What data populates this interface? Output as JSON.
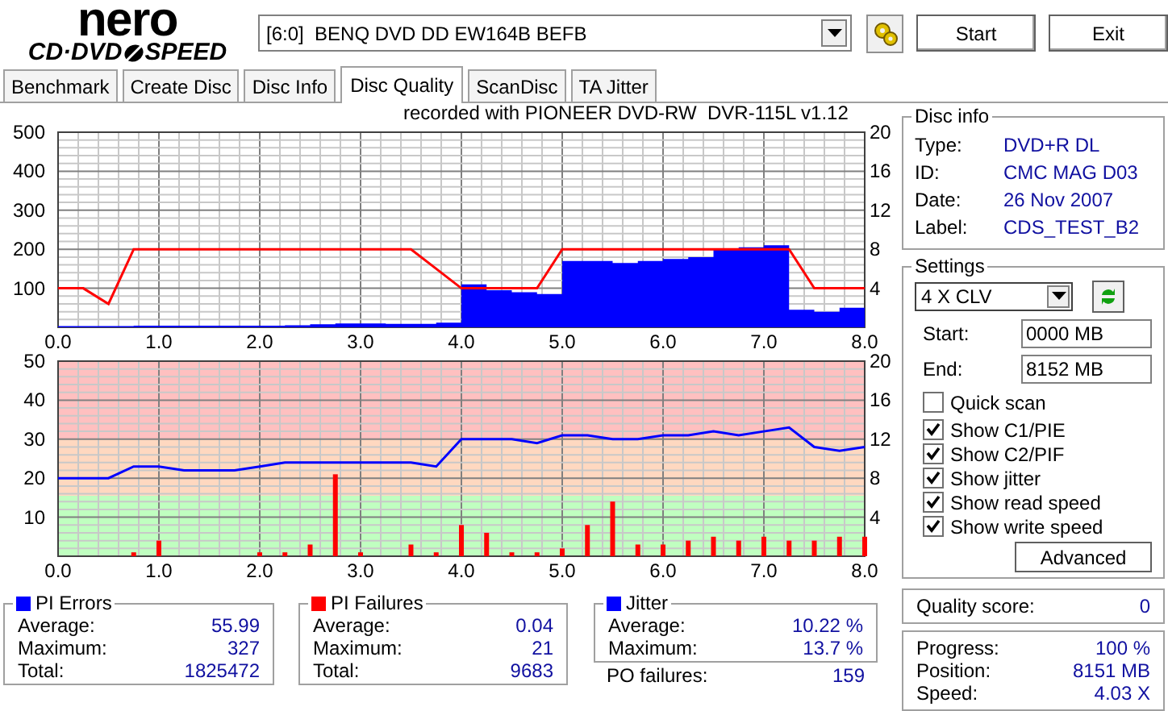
{
  "logo": {
    "word": "nero",
    "left": "CD·DVD",
    "right": "SPEED"
  },
  "drive": {
    "value": "[6:0]  BENQ DVD DD EW164B BEFB"
  },
  "buttons": [
    {
      "label": "Start"
    },
    {
      "label": "Exit"
    }
  ],
  "tabs": [
    {
      "label": "Benchmark",
      "selected": false
    },
    {
      "label": "Create Disc",
      "selected": false
    },
    {
      "label": "Disc Info",
      "selected": false
    },
    {
      "label": "Disc Quality",
      "selected": true
    },
    {
      "label": "ScanDisc",
      "selected": false
    },
    {
      "label": "TA Jitter",
      "selected": false
    }
  ],
  "caption": "recorded with PIONEER DVD-RW  DVR-115L v1.12",
  "charts": [
    {
      "right_axis_labels": [
        "20",
        "16",
        "12",
        "8",
        "4"
      ],
      "chart_data": {
        "type": "area",
        "grid": true,
        "xlim": [
          0,
          8
        ],
        "ylim": [
          0,
          500
        ],
        "xticks": [
          {
            "value": 0,
            "label": "0.0"
          },
          {
            "value": 1,
            "label": "1.0"
          },
          {
            "value": 2,
            "label": "2.0"
          },
          {
            "value": 3,
            "label": "3.0"
          },
          {
            "value": 4,
            "label": "4.0"
          },
          {
            "value": 5,
            "label": "5.0"
          },
          {
            "value": 6,
            "label": "6.0"
          },
          {
            "value": 7,
            "label": "7.0"
          },
          {
            "value": 8,
            "label": "8.0"
          }
        ],
        "yticks": [
          100,
          200,
          300,
          400,
          500
        ],
        "x": [
          0,
          0.25,
          0.5,
          0.75,
          1,
          1.25,
          1.5,
          1.75,
          2,
          2.25,
          2.5,
          2.75,
          3,
          3.25,
          3.5,
          3.75,
          4,
          4.25,
          4.5,
          4.75,
          5,
          5.25,
          5.5,
          5.75,
          6,
          6.25,
          6.5,
          6.75,
          7,
          7.25,
          7.5,
          7.75,
          8
        ],
        "series": [
          {
            "color": "#0000ff",
            "values": [
              3,
              3,
              3,
              4,
              4,
              4,
              4,
              4,
              4,
              5,
              8,
              10,
              10,
              9,
              9,
              12,
              110,
              95,
              90,
              85,
              170,
              170,
              165,
              170,
              175,
              180,
              200,
              205,
              210,
              45,
              40,
              50,
              55
            ]
          },
          {
            "color": "#ff0000",
            "type": "line",
            "values": [
              100,
              100,
              60,
              200,
              200,
              200,
              200,
              200,
              200,
              200,
              200,
              200,
              200,
              200,
              200,
              150,
              100,
              100,
              100,
              100,
              200,
              200,
              200,
              200,
              200,
              200,
              200,
              200,
              200,
              200,
              100,
              100,
              100
            ]
          }
        ]
      }
    },
    {
      "right_axis_labels": [
        "20",
        "16",
        "12",
        "8",
        "4"
      ],
      "zones": [
        {
          "color": "#c0ffc0"
        },
        {
          "color": "#ffd8c0"
        },
        {
          "color": "#ffc0c0"
        }
      ],
      "chart_data": {
        "type": "line",
        "grid": true,
        "xlim": [
          0,
          8
        ],
        "ylim": [
          0,
          50
        ],
        "xticks": [
          {
            "value": 0,
            "label": "0.0"
          },
          {
            "value": 1,
            "label": "1.0"
          },
          {
            "value": 2,
            "label": "2.0"
          },
          {
            "value": 3,
            "label": "3.0"
          },
          {
            "value": 4,
            "label": "4.0"
          },
          {
            "value": 5,
            "label": "5.0"
          },
          {
            "value": 6,
            "label": "6.0"
          },
          {
            "value": 7,
            "label": "7.0"
          },
          {
            "value": 8,
            "label": "8.0"
          }
        ],
        "yticks": [
          10,
          20,
          30,
          40,
          50
        ],
        "x": [
          0,
          0.25,
          0.5,
          0.75,
          1,
          1.25,
          1.5,
          1.75,
          2,
          2.25,
          2.5,
          2.75,
          3,
          3.25,
          3.5,
          3.75,
          4,
          4.25,
          4.5,
          4.75,
          5,
          5.25,
          5.5,
          5.75,
          6,
          6.25,
          6.5,
          6.75,
          7,
          7.25,
          7.5,
          7.75,
          8
        ],
        "series": [
          {
            "color": "#ff0000",
            "type": "bar",
            "values": [
              0,
              0,
              0,
              1,
              4,
              0,
              0,
              0,
              1,
              1,
              3,
              21,
              1,
              0,
              3,
              1,
              8,
              6,
              1,
              1,
              2,
              8,
              14,
              3,
              3,
              4,
              5,
              4,
              5,
              4,
              4,
              5,
              5
            ]
          },
          {
            "color": "#0000ff",
            "values": [
              20,
              20,
              20,
              23,
              23,
              22,
              22,
              22,
              23,
              24,
              24,
              24,
              24,
              24,
              24,
              23,
              30,
              30,
              30,
              29,
              31,
              31,
              30,
              30,
              31,
              31,
              32,
              31,
              32,
              33,
              28,
              27,
              28
            ]
          }
        ]
      }
    }
  ],
  "stats": [
    {
      "title": "PI Errors",
      "color": "#0000ff",
      "rows": [
        {
          "label": "Average:",
          "value": "55.99"
        },
        {
          "label": "Maximum:",
          "value": "327"
        },
        {
          "label": "Total:",
          "value": "1825472"
        }
      ]
    },
    {
      "title": "PI Failures",
      "color": "#ff0000",
      "rows": [
        {
          "label": "Average:",
          "value": "0.04"
        },
        {
          "label": "Maximum:",
          "value": "21"
        },
        {
          "label": "Total:",
          "value": "9683"
        }
      ]
    },
    {
      "title": "Jitter",
      "color": "#0000ff",
      "rows": [
        {
          "label": "Average:",
          "value": "10.22 %"
        },
        {
          "label": "Maximum:",
          "value": "13.7 %"
        }
      ]
    }
  ],
  "po_failures": {
    "label": "PO failures:",
    "value": "159"
  },
  "disc_info": {
    "title": "Disc info",
    "rows": [
      {
        "label": "Type:",
        "value": "DVD+R DL"
      },
      {
        "label": "ID:",
        "value": "CMC MAG D03"
      },
      {
        "label": "Date:",
        "value": "26 Nov 2007"
      },
      {
        "label": "Label:",
        "value": "CDS_TEST_B2"
      }
    ]
  },
  "settings": {
    "title": "Settings",
    "speed": "4 X CLV",
    "start": {
      "label": "Start:",
      "value": "0000 MB"
    },
    "end": {
      "label": "End:",
      "value": "8152 MB"
    },
    "options": [
      {
        "label": "Quick scan",
        "checked": false
      },
      {
        "label": "Show C1/PIE",
        "checked": true
      },
      {
        "label": "Show C2/PIF",
        "checked": true
      },
      {
        "label": "Show jitter",
        "checked": true
      },
      {
        "label": "Show read speed",
        "checked": true
      },
      {
        "label": "Show write speed",
        "checked": true
      }
    ],
    "advanced": "Advanced"
  },
  "quality": {
    "label": "Quality score:",
    "value": "0"
  },
  "progress": [
    {
      "label": "Progress:",
      "value": "100 %"
    },
    {
      "label": "Position:",
      "value": "8151 MB"
    },
    {
      "label": "Speed:",
      "value": "4.03 X"
    }
  ]
}
